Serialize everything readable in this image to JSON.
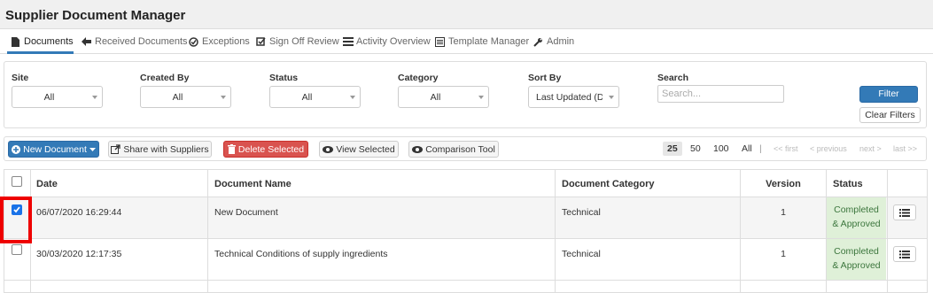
{
  "app": {
    "title": "Supplier Document Manager"
  },
  "nav": {
    "items": [
      {
        "label": "Documents",
        "icon": "document-icon",
        "active": true
      },
      {
        "label": "Received Documents",
        "icon": "arrow-left-icon"
      },
      {
        "label": "Exceptions",
        "icon": "check-circle-icon"
      },
      {
        "label": "Sign Off Review",
        "icon": "checkbox-icon"
      },
      {
        "label": "Activity Overview",
        "icon": "list-icon"
      },
      {
        "label": "Template Manager",
        "icon": "template-icon"
      },
      {
        "label": "Admin",
        "icon": "wrench-icon"
      }
    ]
  },
  "filters": {
    "site": {
      "label": "Site",
      "value": "All"
    },
    "created_by": {
      "label": "Created By",
      "value": "All"
    },
    "status": {
      "label": "Status",
      "value": "All"
    },
    "category": {
      "label": "Category",
      "value": "All"
    },
    "sort_by": {
      "label": "Sort By",
      "value": "Last Updated (Desc"
    },
    "search": {
      "label": "Search",
      "placeholder": "Search..."
    },
    "filter_button": "Filter",
    "clear_button": "Clear Filters"
  },
  "toolbar": {
    "new_document": "New Document",
    "share": "Share with Suppliers",
    "delete": "Delete Selected",
    "view": "View Selected",
    "compare": "Comparison Tool"
  },
  "pagination": {
    "sizes": [
      "25",
      "50",
      "100",
      "All"
    ],
    "current_size": "25",
    "separator": "|",
    "first": "<< first",
    "previous": "< previous",
    "next": "next >",
    "last": "last >>"
  },
  "table": {
    "columns": [
      "Date",
      "Document Name",
      "Document Category",
      "Version",
      "Status"
    ],
    "rows": [
      {
        "checked": true,
        "date": "06/07/2020 16:29:44",
        "name": "New Document",
        "category": "Technical",
        "version": "1",
        "status_line1": "Completed",
        "status_line2": "& Approved"
      },
      {
        "checked": false,
        "date": "30/03/2020 12:17:35",
        "name": "Technical Conditions of supply ingredients",
        "category": "Technical",
        "version": "1",
        "status_line1": "Completed",
        "status_line2": "& Approved"
      }
    ]
  },
  "colors": {
    "primary": "#337ab7",
    "danger": "#d9534f",
    "status_bg": "#dff0d8",
    "status_text": "#3c763d",
    "highlight": "#ee0000",
    "selected_row": "#f5f5f5"
  }
}
